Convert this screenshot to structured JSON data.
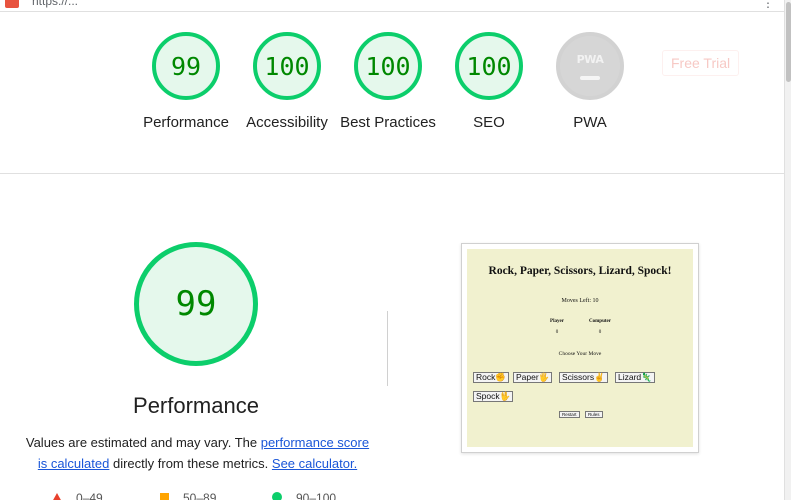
{
  "browser": {
    "url": "https://...",
    "menu_icon": "kebab-icon"
  },
  "summary": {
    "gauges": [
      {
        "label": "Performance",
        "score": "99"
      },
      {
        "label": "Accessibility",
        "score": "100"
      },
      {
        "label": "Best Practices",
        "score": "100"
      },
      {
        "label": "SEO",
        "score": "100"
      },
      {
        "label": "PWA",
        "badge": "PWA"
      }
    ],
    "free_trial": "Free Trial"
  },
  "performance": {
    "score": "99",
    "title": "Performance",
    "desc_prefix": "Values are estimated and may vary. The ",
    "link_score": "performance score is calculated",
    "desc_middle": " directly from these metrics. ",
    "link_calc": "See calculator.",
    "legend": [
      {
        "range": "0–49",
        "shape": "triangle",
        "color": "#e8412c"
      },
      {
        "range": "50–89",
        "shape": "square",
        "color": "#ffa400"
      },
      {
        "range": "90–100",
        "shape": "circle",
        "color": "#0cce6b"
      }
    ]
  },
  "screenshot": {
    "title": "Rock, Paper, Scissors, Lizard, Spock!",
    "moves": "Moves Left: 10",
    "player_label": "Player",
    "computer_label": "Computer",
    "player_score": "0",
    "computer_score": "0",
    "choose": "Choose Your Move",
    "buttons": [
      "Rock✊",
      "Paper🖐",
      "Scissors✌",
      "Lizard🦎",
      "Spock🖖"
    ],
    "restart": "Restart",
    "rules": "Rules"
  },
  "colors": {
    "pass": "#0cce6b",
    "pass_text": "#008800",
    "average": "#ffa400",
    "fail": "#e8412c",
    "link": "#1a56d8",
    "thumbnail_bg": "#f1f1cf"
  }
}
